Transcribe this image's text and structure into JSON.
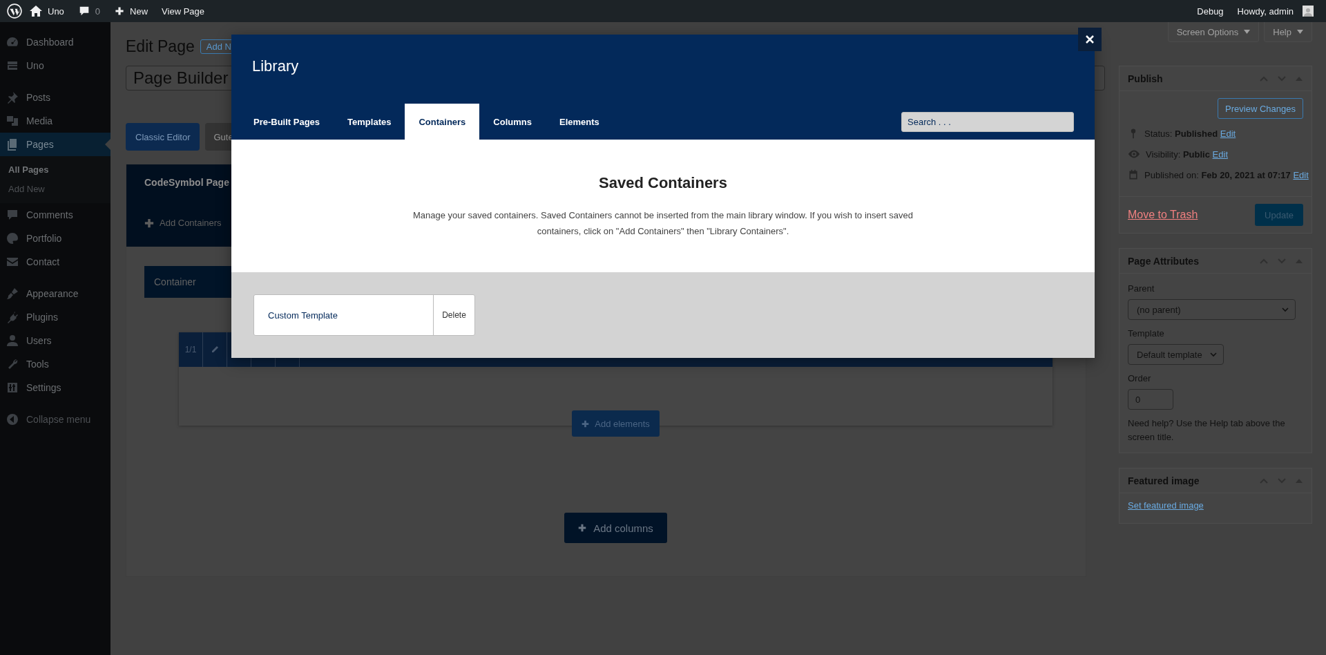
{
  "admin_bar": {
    "items": [
      {
        "label": "Uno"
      },
      {
        "label": "0"
      },
      {
        "label": "New"
      },
      {
        "label": "View Page"
      }
    ],
    "right": [
      {
        "label": "Debug"
      },
      {
        "label": "Howdy, admin"
      }
    ]
  },
  "sidebar": {
    "groups": [
      {
        "items": [
          {
            "label": "Dashboard",
            "selected": false
          },
          {
            "label": "Uno",
            "selected": false
          }
        ]
      },
      {
        "items": [
          {
            "label": "Posts",
            "selected": false
          },
          {
            "label": "Media",
            "selected": false
          },
          {
            "label": "Pages",
            "selected": true,
            "children": [
              {
                "label": "All Pages",
                "selected": true
              },
              {
                "label": "Add New",
                "selected": false
              }
            ]
          },
          {
            "label": "Comments",
            "selected": false
          },
          {
            "label": "Portfolio",
            "selected": false
          },
          {
            "label": "Contact",
            "selected": false
          }
        ]
      },
      {
        "items": [
          {
            "label": "Appearance",
            "selected": false
          },
          {
            "label": "Plugins",
            "selected": false
          },
          {
            "label": "Users",
            "selected": false
          },
          {
            "label": "Tools",
            "selected": false
          },
          {
            "label": "Settings",
            "selected": false
          }
        ]
      }
    ],
    "collapse": "Collapse menu"
  },
  "edit_page": {
    "heading": "Edit Page",
    "add_new": "Add N",
    "title_value": "Page Builder",
    "editor_buttons": [
      {
        "label": "Classic Editor",
        "selected": true
      },
      {
        "label": "Gute",
        "selected": false
      }
    ]
  },
  "builder": {
    "title": "CodeSymbol Page",
    "add_containers": "Add Containers",
    "container": {
      "title": "Container",
      "column_ratio": "1/1",
      "add_elements": "Add elements"
    },
    "add_columns": "Add columns"
  },
  "screen_options": {
    "options": "Screen Options",
    "help": "Help"
  },
  "publish": {
    "title": "Publish",
    "preview": "Preview Changes",
    "rows": [
      {
        "text": "Status: **Published**",
        "link": "Edit"
      },
      {
        "text": "Visibility: **Public**",
        "link": "Edit"
      },
      {
        "text": "Published on: **Feb 20, 2021 at 07:17**",
        "link": "Edit"
      }
    ],
    "trash": "Move to Trash",
    "update": "Update"
  },
  "page_attributes": {
    "title": "Page Attributes",
    "parent_label": "Parent",
    "parent_value": "(no parent)",
    "template_label": "Template",
    "template_value": "Default template",
    "order_label": "Order",
    "order_value": "0",
    "help": "Need help? Use the Help tab above the screen title."
  },
  "featured_image": {
    "title": "Featured image",
    "link": "Set featured image"
  },
  "modal": {
    "title": "Library",
    "tabs": [
      {
        "label": "Pre-Built Pages",
        "selected": false
      },
      {
        "label": "Templates",
        "selected": false
      },
      {
        "label": "Containers",
        "selected": true
      },
      {
        "label": "Columns",
        "selected": false
      },
      {
        "label": "Elements",
        "selected": false
      }
    ],
    "search": {
      "placeholder": "Search . . ."
    },
    "heading": "Saved Containers",
    "description": "Manage your saved containers. Saved Containers cannot be inserted from the main library window. If you wish to insert saved containers, click on \"Add Containers\" then \"Library Containers\".",
    "items": [
      {
        "name": "Custom Template",
        "action": "Delete"
      }
    ]
  }
}
